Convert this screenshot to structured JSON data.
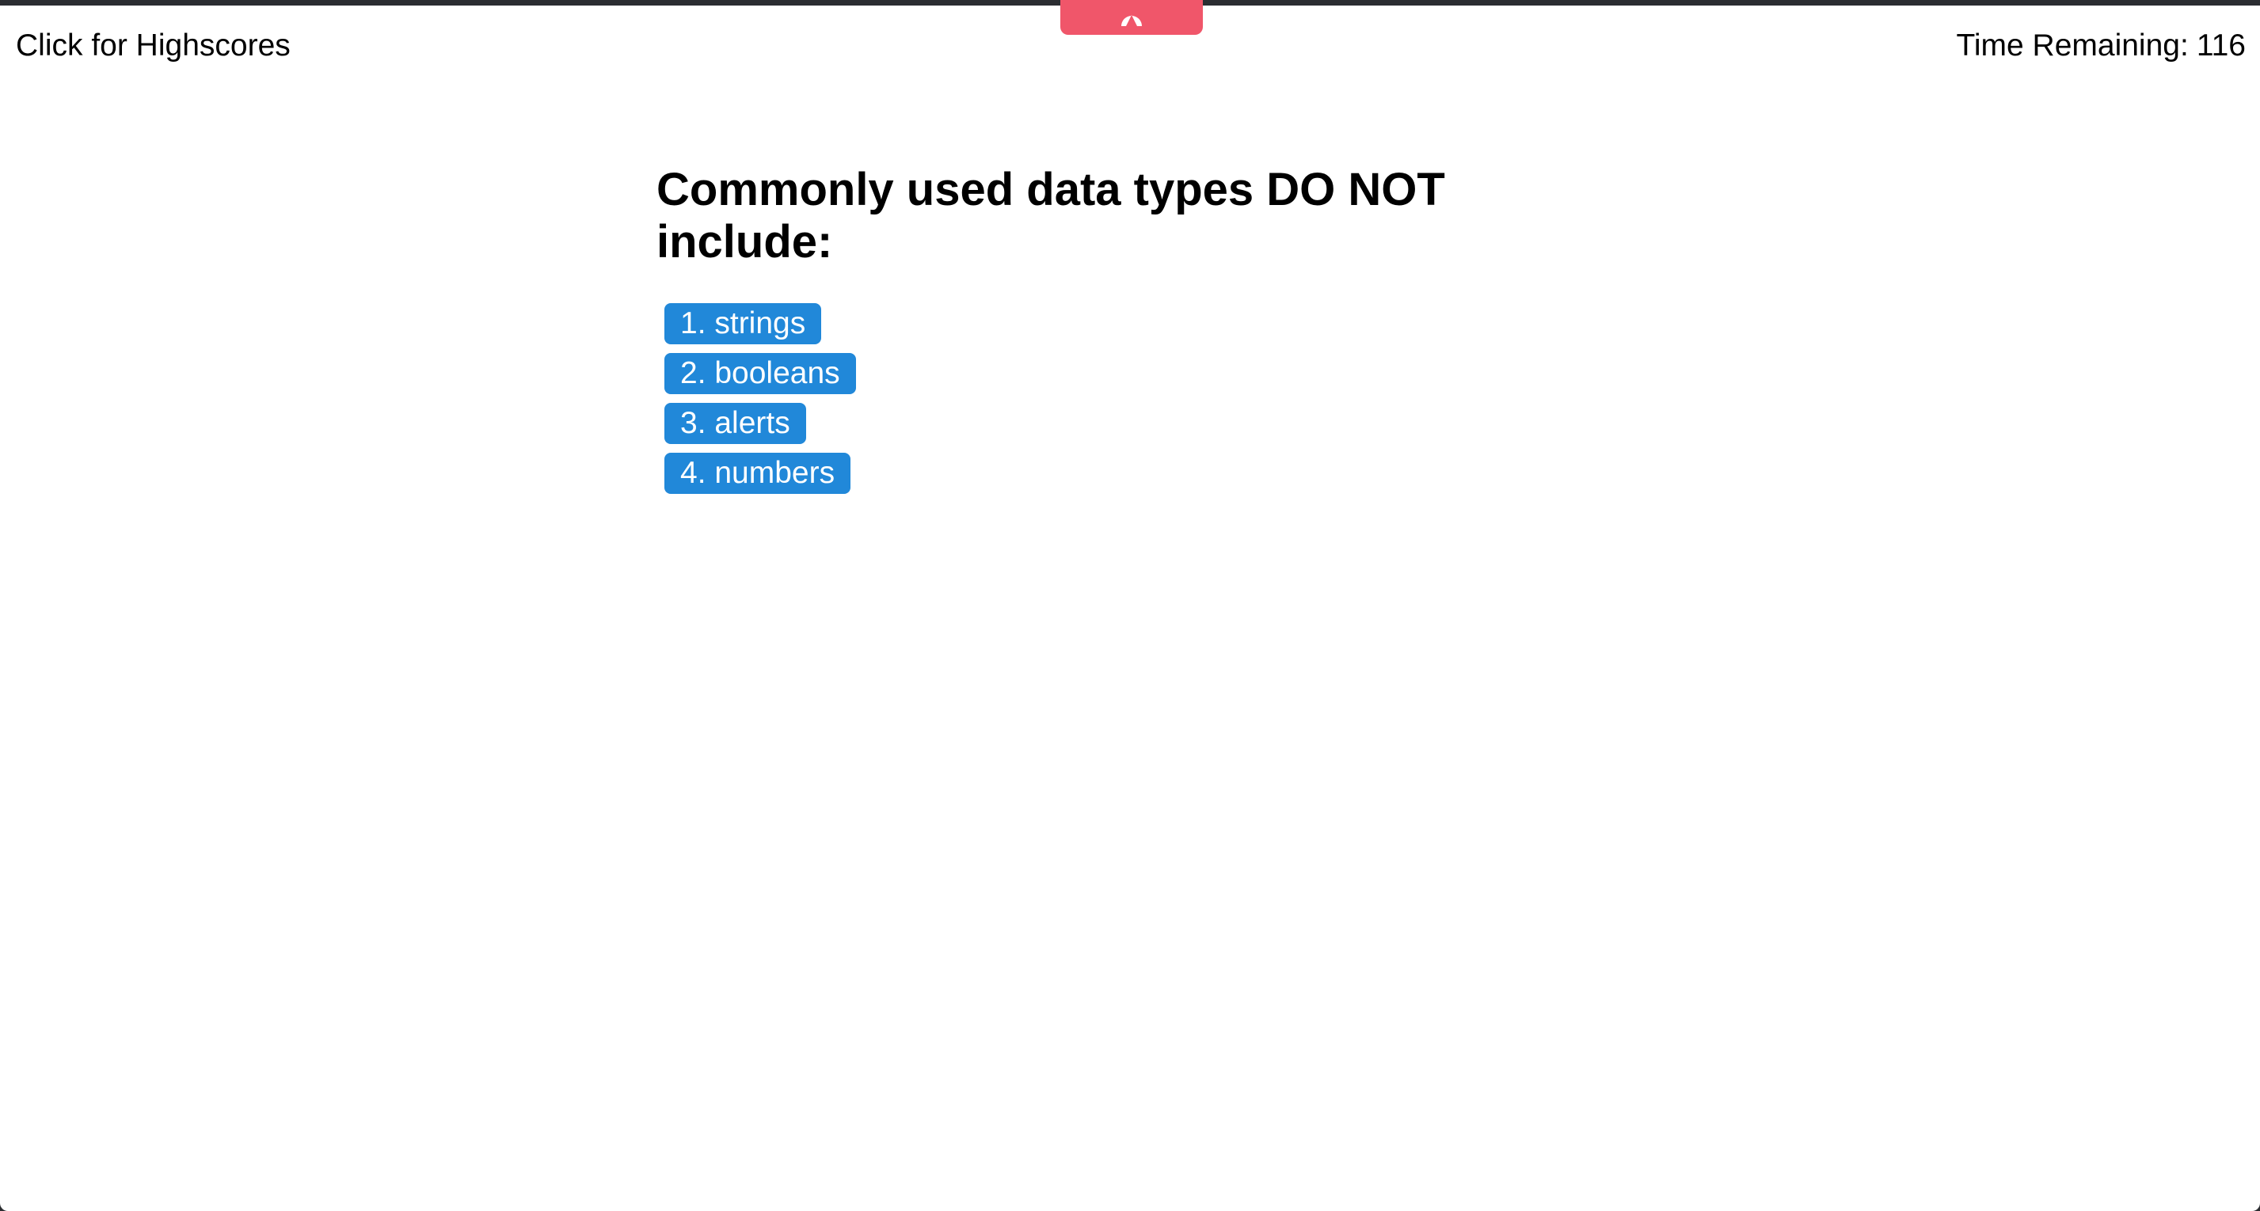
{
  "header": {
    "highscores_label": "Click for Highscores",
    "timer_label": "Time Remaining:",
    "timer_value": "116"
  },
  "toolbar_notch": {
    "icon": "arrow-up-icon",
    "color": "#f0566a"
  },
  "quiz": {
    "question": "Commonly used data types DO NOT include:",
    "choices": [
      {
        "label": "1. strings"
      },
      {
        "label": "2. booleans"
      },
      {
        "label": "3. alerts"
      },
      {
        "label": "4. numbers"
      }
    ],
    "button_color": "#2188d9"
  }
}
